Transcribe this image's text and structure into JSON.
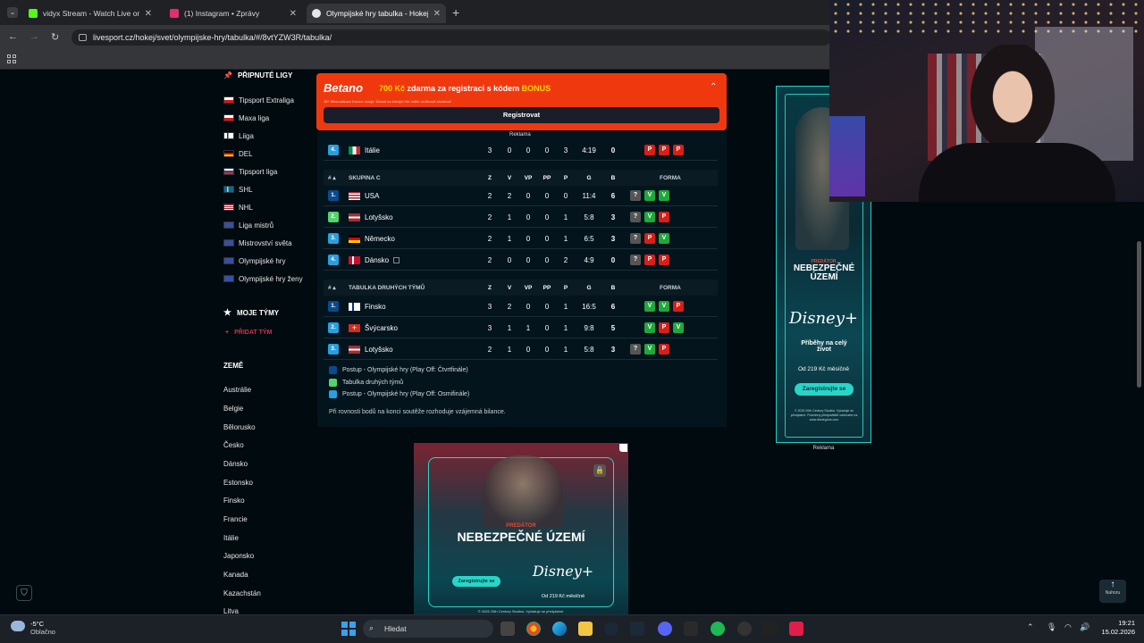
{
  "browser": {
    "tabs": [
      {
        "title": "vidyx Stream - Watch Live on Kick",
        "color": "#53fc18"
      },
      {
        "title": "(1) Instagram • Zprávy",
        "color": "#e1306c"
      },
      {
        "title": "Olympijské hry tabulka - Hokej",
        "color": "#e6e6e6"
      }
    ],
    "url": "livesport.cz/hokej/svet/olympijske-hry/tabulka/#/8vtYZW3R/tabulka/"
  },
  "sidebar": {
    "pinned_title": "PŘIPNUTÉ LIGY",
    "leagues": [
      "Tipsport Extraliga",
      "Maxa liga",
      "Liiga",
      "DEL",
      "Tipsport liga",
      "SHL",
      "NHL",
      "Liga mistrů",
      "Mistrovství světa",
      "Olympijské hry",
      "Olympijské hry ženy"
    ],
    "my_teams_title": "MOJE TÝMY",
    "add_team": "PŘIDAT TÝM",
    "countries_title": "ZEMĚ",
    "countries": [
      "Austrálie",
      "Belgie",
      "Bělorusko",
      "Česko",
      "Dánsko",
      "Estonsko",
      "Finsko",
      "Francie",
      "Itálie",
      "Japonsko",
      "Kanada",
      "Kazachstán",
      "Litva"
    ]
  },
  "betano": {
    "logo": "Betano",
    "amount": "700 Kč",
    "text": "zdarma za registraci s kódem",
    "code": "BONUS",
    "fine": "18+ Minimalizace Kozoví varuje: Účastí na loterijní hře může vzniknout závislost!",
    "button": "Registrovat"
  },
  "ad_label": "Reklama",
  "prev_row": {
    "rank": "4.",
    "team": "Itálie",
    "z": "3",
    "v": "0",
    "vp": "0",
    "pp": "0",
    "p": "3",
    "g": "4:19",
    "b": "0",
    "form": [
      "P",
      "P",
      "P"
    ]
  },
  "group_c": {
    "cols": {
      "rank": "#",
      "name": "SKUPINA C",
      "z": "Z",
      "v": "V",
      "vp": "VP",
      "pp": "PP",
      "p": "P",
      "g": "G",
      "b": "B",
      "forma": "FORMA"
    },
    "rows": [
      {
        "rank": "1.",
        "team": "USA",
        "z": "2",
        "v": "2",
        "vp": "0",
        "pp": "0",
        "p": "0",
        "g": "11:4",
        "b": "6",
        "form": [
          "?",
          "V",
          "V"
        ]
      },
      {
        "rank": "2.",
        "team": "Lotyšsko",
        "z": "2",
        "v": "1",
        "vp": "0",
        "pp": "0",
        "p": "1",
        "g": "5:8",
        "b": "3",
        "form": [
          "?",
          "V",
          "P"
        ]
      },
      {
        "rank": "3.",
        "team": "Německo",
        "z": "2",
        "v": "1",
        "vp": "0",
        "pp": "0",
        "p": "1",
        "g": "6:5",
        "b": "3",
        "form": [
          "?",
          "P",
          "V"
        ]
      },
      {
        "rank": "4.",
        "team": "Dánsko",
        "z": "2",
        "v": "0",
        "vp": "0",
        "pp": "0",
        "p": "2",
        "g": "4:9",
        "b": "0",
        "form": [
          "?",
          "P",
          "P"
        ]
      }
    ]
  },
  "second": {
    "cols": {
      "rank": "#",
      "name": "TABULKA DRUHÝCH TÝMŮ",
      "z": "Z",
      "v": "V",
      "vp": "VP",
      "pp": "PP",
      "p": "P",
      "g": "G",
      "b": "B",
      "forma": "FORMA"
    },
    "rows": [
      {
        "rank": "1.",
        "team": "Finsko",
        "z": "3",
        "v": "2",
        "vp": "0",
        "pp": "0",
        "p": "1",
        "g": "16:5",
        "b": "6",
        "form": [
          "V",
          "V",
          "P"
        ]
      },
      {
        "rank": "2.",
        "team": "Švýcarsko",
        "z": "3",
        "v": "1",
        "vp": "1",
        "pp": "0",
        "p": "1",
        "g": "9:8",
        "b": "5",
        "form": [
          "V",
          "P",
          "V"
        ]
      },
      {
        "rank": "3.",
        "team": "Lotyšsko",
        "z": "2",
        "v": "1",
        "vp": "0",
        "pp": "0",
        "p": "1",
        "g": "5:8",
        "b": "3",
        "form": [
          "?",
          "V",
          "P"
        ]
      }
    ]
  },
  "legend": [
    {
      "text": "Postup - Olympijské hry (Play Off: Čtvrtfinále)",
      "color": "#0b4a8c"
    },
    {
      "text": "Tabulka druhých týmů",
      "color": "#54d36c"
    },
    {
      "text": "Postup - Olympijské hry (Play Off: Osmifinále)",
      "color": "#2a9fe0"
    }
  ],
  "note": "Při rovnosti bodů na konci soutěže rozhoduje vzájemná bilance.",
  "ad_right": {
    "kicker": "PREDÁTOR",
    "title": "NEBEZPEČNÉ ÚZEMÍ",
    "brand": "Disney+",
    "tagline": "Příběhy na celý život",
    "price": "Od 219 Kč měsíčně",
    "cta": "Zaregistrujte se",
    "label": "Reklama",
    "fine": "© 2026 20th Century Studios. Vyžaduje se předplatné. Podrobný předplatitelů naleznete na www.disneyplus.com"
  },
  "ad_bottom": {
    "kicker": "PREDÁTOR",
    "title": "NEBEZPEČNÉ ÚZEMÍ",
    "cta": "Zaregistrujte se",
    "brand": "Disney+",
    "price": "Od 219 Kč měsíčně",
    "fine": "© 2026 20th Century Studios. Vyžaduje se předplatné."
  },
  "back_top": "Nahoru",
  "taskbar": {
    "weather_temp": "-5°C",
    "weather_desc": "Oblačno",
    "search": "Hledat",
    "time": "19:21",
    "date": "15.02.2026"
  }
}
